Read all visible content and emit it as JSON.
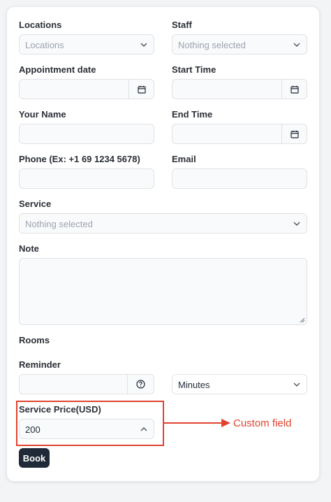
{
  "form": {
    "locations": {
      "label": "Locations",
      "placeholder": "Locations"
    },
    "staff": {
      "label": "Staff",
      "placeholder": "Nothing selected"
    },
    "appointment_date": {
      "label": "Appointment date",
      "value": ""
    },
    "start_time": {
      "label": "Start Time",
      "value": ""
    },
    "your_name": {
      "label": "Your Name",
      "value": ""
    },
    "end_time": {
      "label": "End Time",
      "value": ""
    },
    "phone": {
      "label": "Phone (Ex: +1 69 1234 5678)",
      "value": ""
    },
    "email": {
      "label": "Email",
      "value": ""
    },
    "service": {
      "label": "Service",
      "placeholder": "Nothing selected"
    },
    "note": {
      "label": "Note",
      "value": ""
    },
    "rooms": {
      "label": "Rooms"
    },
    "reminder": {
      "label": "Reminder",
      "value": "",
      "unit": "Minutes"
    },
    "service_price": {
      "label": "Service Price(USD)",
      "value": "200"
    },
    "book_label": "Book"
  },
  "annotation": {
    "text": "Custom field",
    "color": "#e0432f"
  },
  "icons": {
    "calendar": "calendar-icon",
    "chevron_down": "chevron-down-icon",
    "chevron_up": "chevron-up-icon",
    "help": "question-circle-icon"
  }
}
